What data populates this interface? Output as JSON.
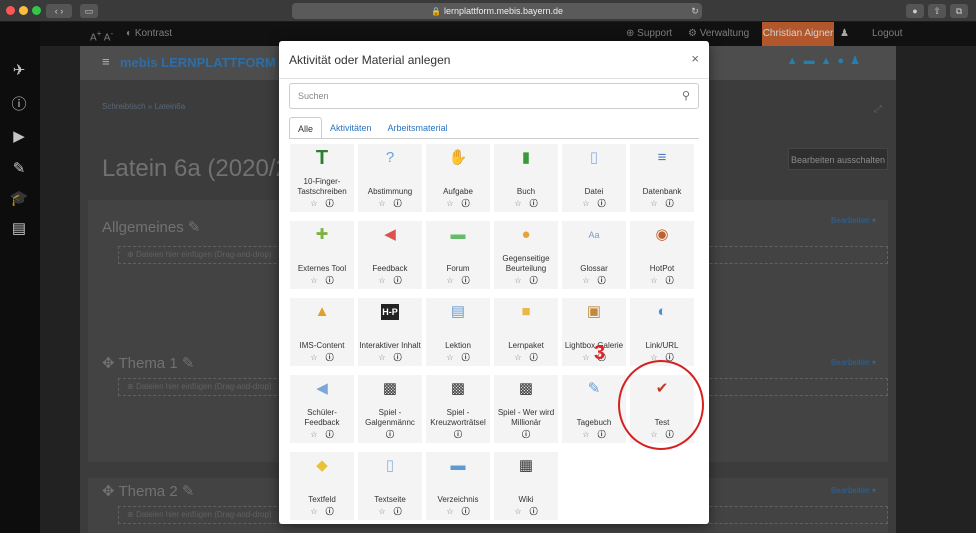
{
  "browser": {
    "url": "lernplattform.mebis.bayern.de"
  },
  "topbar": {
    "font_larger": "A",
    "font_smaller": "A",
    "contrast": "Kontrast",
    "support": "Support",
    "admin": "Verwaltung",
    "user": "Christian Aigner",
    "logout": "Logout"
  },
  "header": {
    "logo": "mebis LERNPLATTFORM"
  },
  "page": {
    "breadcrumb": "Schreibtisch » Latein6a",
    "course_title": "Latein 6a (2020/2",
    "edit_button": "Bearbeiten ausschalten",
    "sections": [
      {
        "title": "Allgemeines",
        "edit": "Bearbeiten",
        "drop": "Dateien hier einfügen (Drag-and-drop)"
      },
      {
        "title": "Thema 1",
        "edit": "Bearbeiten",
        "drop": "Dateien hier einfügen (Drag-and-drop)"
      },
      {
        "title": "Thema 2",
        "edit": "Bearbeiten",
        "drop": "Dateien hier einfügen (Drag-and-drop)"
      }
    ]
  },
  "modal": {
    "title": "Aktivität oder Material anlegen",
    "close": "×",
    "search_placeholder": "Suchen",
    "tabs": [
      "Alle",
      "Aktivitäten",
      "Arbeitsmaterial"
    ],
    "items": [
      {
        "name": "10-Finger-Tastschreiben",
        "icon": "T",
        "color": "#2e7d32"
      },
      {
        "name": "Abstimmung",
        "icon": "?",
        "color": "#6aa0d8"
      },
      {
        "name": "Aufgabe",
        "icon": "✋",
        "color": "#5b8fc7"
      },
      {
        "name": "Buch",
        "icon": "▮",
        "color": "#3a9a3a"
      },
      {
        "name": "Datei",
        "icon": "▯",
        "color": "#8db4e2"
      },
      {
        "name": "Datenbank",
        "icon": "≡",
        "color": "#4a7fc1"
      },
      {
        "name": "Externes Tool",
        "icon": "✚",
        "color": "#7cb342"
      },
      {
        "name": "Feedback",
        "icon": "◀",
        "color": "#d9534f"
      },
      {
        "name": "Forum",
        "icon": "▬",
        "color": "#66bb6a"
      },
      {
        "name": "Gegenseitige Beurteilung",
        "icon": "●",
        "color": "#e8a33a"
      },
      {
        "name": "Glossar",
        "icon": "Aa",
        "color": "#7a9ccc"
      },
      {
        "name": "HotPot",
        "icon": "◉",
        "color": "#c0602a"
      },
      {
        "name": "IMS-Content",
        "icon": "▲",
        "color": "#e0a030"
      },
      {
        "name": "Interaktiver Inhalt",
        "icon": "H-P",
        "color": "#222222"
      },
      {
        "name": "Lektion",
        "icon": "▤",
        "color": "#6a9bd1"
      },
      {
        "name": "Lernpaket",
        "icon": "■",
        "color": "#e8b84a"
      },
      {
        "name": "Lightbox Galerie",
        "icon": "▣",
        "color": "#c08a3a"
      },
      {
        "name": "Link/URL",
        "icon": "◐",
        "color": "#4a90d9"
      },
      {
        "name": "Schüler-Feedback",
        "icon": "◀",
        "color": "#7aa6d8"
      },
      {
        "name": "Spiel - Galgenmännc",
        "icon": "▩",
        "color": "#3a3a3a"
      },
      {
        "name": "Spiel - Kreuzworträtsel",
        "icon": "▩",
        "color": "#3a3a3a"
      },
      {
        "name": "Spiel - Wer wird Millionär",
        "icon": "▩",
        "color": "#3a3a3a"
      },
      {
        "name": "Tagebuch",
        "icon": "✎",
        "color": "#6a9bd1"
      },
      {
        "name": "Test",
        "icon": "✔",
        "color": "#c0392b"
      },
      {
        "name": "Textfeld",
        "icon": "◆",
        "color": "#e8c33a"
      },
      {
        "name": "Textseite",
        "icon": "▯",
        "color": "#8db4e2"
      },
      {
        "name": "Verzeichnis",
        "icon": "▬",
        "color": "#5b9bd5"
      },
      {
        "name": "Wiki",
        "icon": "▦",
        "color": "#333333"
      }
    ]
  },
  "annotation": {
    "number": "3"
  }
}
